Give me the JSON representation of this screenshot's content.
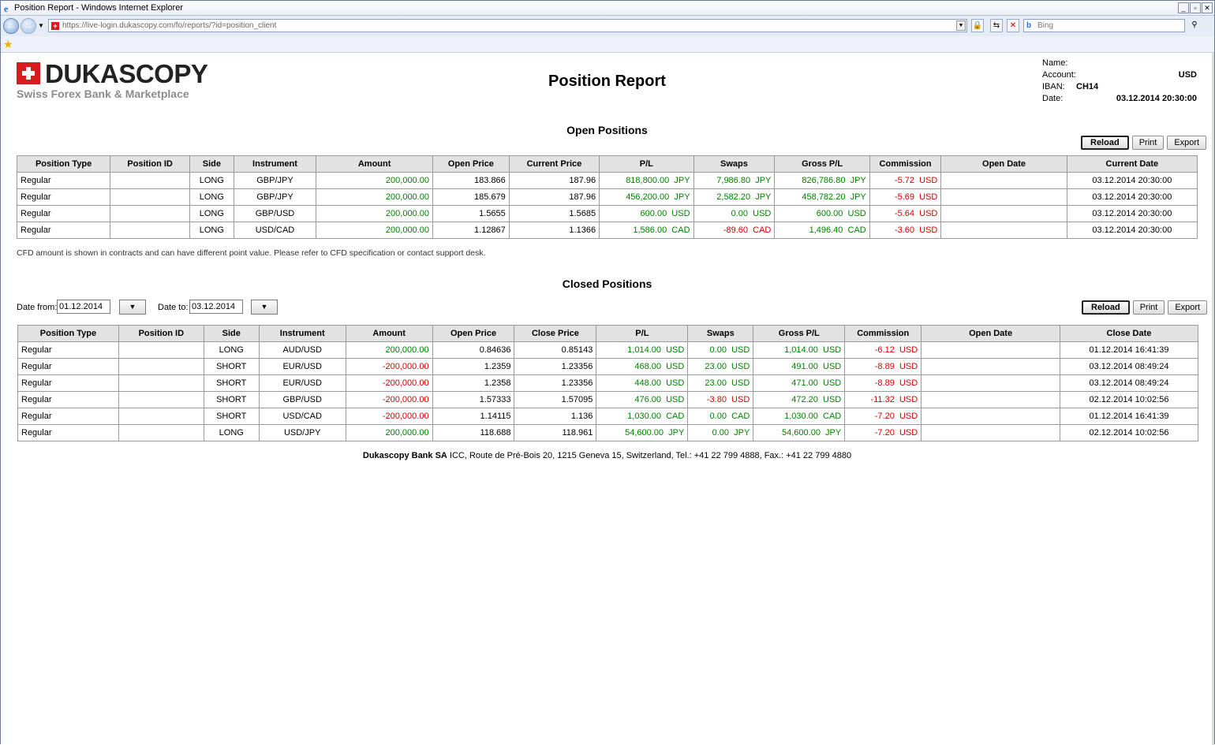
{
  "browser": {
    "window_title": "Position Report - Windows Internet Explorer",
    "url": "https://live-login.dukascopy.com/fo/reports/?id=position_client",
    "search_placeholder": "Bing"
  },
  "brand": {
    "name": "DUKASCOPY",
    "tagline": "Swiss Forex Bank & Marketplace"
  },
  "report_title": "Position Report",
  "account_info": {
    "name_label": "Name:",
    "name_value": "",
    "account_label": "Account:",
    "account_value": "USD",
    "iban_label": "IBAN:",
    "iban_value": "CH14",
    "date_label": "Date:",
    "date_value": "03.12.2014 20:30:00"
  },
  "open_positions": {
    "title": "Open Positions",
    "buttons": {
      "reload": "Reload",
      "print": "Print",
      "export": "Export"
    },
    "columns": [
      "Position Type",
      "Position ID",
      "Side",
      "Instrument",
      "Amount",
      "Open Price",
      "Current Price",
      "P/L",
      "Swaps",
      "Gross P/L",
      "Commission",
      "Open Date",
      "Current Date"
    ],
    "rows": [
      [
        "Regular",
        "",
        "LONG",
        "GBP/JPY",
        "200,000.00",
        "183.866",
        "187.96",
        "818,800.00  JPY",
        "7,986.80  JPY",
        "826,786.80  JPY",
        "-5.72  USD",
        "",
        "03.12.2014 20:30:00"
      ],
      [
        "Regular",
        "",
        "LONG",
        "GBP/JPY",
        "200,000.00",
        "185.679",
        "187.96",
        "456,200.00  JPY",
        "2,582.20  JPY",
        "458,782.20  JPY",
        "-5.69  USD",
        "",
        "03.12.2014 20:30:00"
      ],
      [
        "Regular",
        "",
        "LONG",
        "GBP/USD",
        "200,000.00",
        "1.5655",
        "1.5685",
        "600.00  USD",
        "0.00  USD",
        "600.00  USD",
        "-5.64  USD",
        "",
        "03.12.2014 20:30:00"
      ],
      [
        "Regular",
        "",
        "LONG",
        "USD/CAD",
        "200,000.00",
        "1.12867",
        "1.1366",
        "1,586.00  CAD",
        "-89.60  CAD",
        "1,496.40  CAD",
        "-3.60  USD",
        "",
        "03.12.2014 20:30:00"
      ]
    ],
    "note": "CFD amount is shown in contracts and can have different point value. Please refer to CFD specification or contact support desk."
  },
  "closed_positions": {
    "title": "Closed Positions",
    "date_from_label": "Date from:",
    "date_from": "01.12.2014",
    "date_to_label": "Date to:",
    "date_to": "03.12.2014",
    "buttons": {
      "reload": "Reload",
      "print": "Print",
      "export": "Export"
    },
    "columns": [
      "Position Type",
      "Position ID",
      "Side",
      "Instrument",
      "Amount",
      "Open Price",
      "Close Price",
      "P/L",
      "Swaps",
      "Gross P/L",
      "Commission",
      "Open Date",
      "Close Date"
    ],
    "rows": [
      [
        "Regular",
        "",
        "LONG",
        "AUD/USD",
        "200,000.00",
        "0.84636",
        "0.85143",
        "1,014.00  USD",
        "0.00  USD",
        "1,014.00  USD",
        "-6.12  USD",
        "",
        "01.12.2014 16:41:39"
      ],
      [
        "Regular",
        "",
        "SHORT",
        "EUR/USD",
        "-200,000.00",
        "1.2359",
        "1.23356",
        "468.00  USD",
        "23.00  USD",
        "491.00  USD",
        "-8.89  USD",
        "",
        "03.12.2014 08:49:24"
      ],
      [
        "Regular",
        "",
        "SHORT",
        "EUR/USD",
        "-200,000.00",
        "1.2358",
        "1.23356",
        "448.00  USD",
        "23.00  USD",
        "471.00  USD",
        "-8.89  USD",
        "",
        "03.12.2014 08:49:24"
      ],
      [
        "Regular",
        "",
        "SHORT",
        "GBP/USD",
        "-200,000.00",
        "1.57333",
        "1.57095",
        "476.00  USD",
        "-3.80  USD",
        "472.20  USD",
        "-11.32  USD",
        "",
        "02.12.2014 10:02:56"
      ],
      [
        "Regular",
        "",
        "SHORT",
        "USD/CAD",
        "-200,000.00",
        "1.14115",
        "1.136",
        "1,030.00  CAD",
        "0.00  CAD",
        "1,030.00  CAD",
        "-7.20  USD",
        "",
        "01.12.2014 16:41:39"
      ],
      [
        "Regular",
        "",
        "LONG",
        "USD/JPY",
        "200,000.00",
        "118.688",
        "118.961",
        "54,600.00  JPY",
        "0.00  JPY",
        "54,600.00  JPY",
        "-7.20  USD",
        "",
        "02.12.2014 10:02:56"
      ]
    ]
  },
  "footer": {
    "bank": "Dukascopy Bank SA",
    "address": " ICC, Route de Pré-Bois 20, 1215 Geneva 15, Switzerland, Tel.: +41 22 799 4888, Fax.: +41 22 799 4880"
  },
  "colors": {
    "positive": "#008000",
    "negative": "#d40000",
    "header_bg": "#e2e2e2",
    "brand_red": "#d61c1c"
  }
}
